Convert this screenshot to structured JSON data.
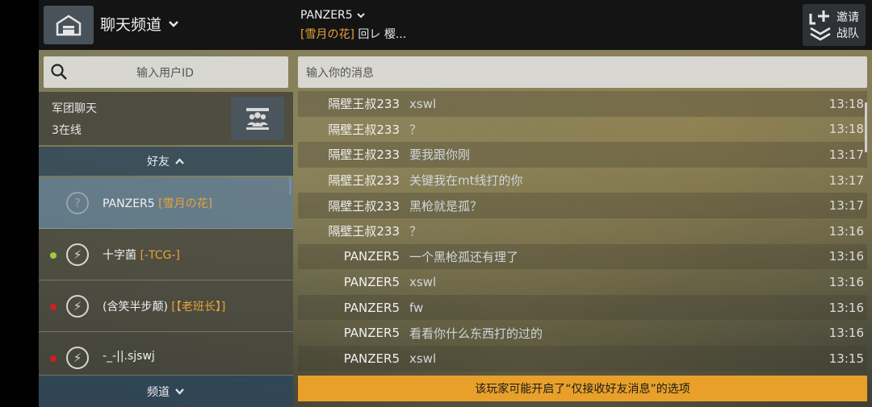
{
  "header": {
    "channel_title": "聊天频道",
    "chat_title": "PANZER5",
    "chat_sub_tag": "[雪月の花]",
    "chat_sub_rest": " 回レ 樱...",
    "invite_label": "邀请 战队"
  },
  "left": {
    "search_placeholder": "输入用户ID",
    "legion_title": "军团聊天",
    "legion_online": "3在线",
    "friends_header": "好友",
    "friends": [
      {
        "name": "PANZER5 ",
        "tag": "[雪月の花]",
        "status": "",
        "icon": "question-icon"
      },
      {
        "name": "十字菌 ",
        "tag": "[-TCG-]",
        "status": "#9ccc3c",
        "icon": "lightning-icon"
      },
      {
        "name": "(含笑半步颠) ",
        "tag": "[【老班长】]",
        "status": "#d02020",
        "icon": "lightning-icon"
      },
      {
        "name": "-_-||.sjswj",
        "tag": "",
        "status": "#d02020",
        "icon": "lightning-icon"
      }
    ],
    "channel_button": "频道"
  },
  "chat": {
    "input_placeholder": "输入你的消息",
    "messages": [
      {
        "sender": "隔壁王叔233",
        "text": "xswl",
        "time": "13:18"
      },
      {
        "sender": "隔壁王叔233",
        "text": "？",
        "time": "13:18"
      },
      {
        "sender": "隔壁王叔233",
        "text": "要我跟你刚",
        "time": "13:17"
      },
      {
        "sender": "隔壁王叔233",
        "text": "关键我在mt线打的你",
        "time": "13:17"
      },
      {
        "sender": "隔壁王叔233",
        "text": "黑枪就是孤？",
        "time": "13:17"
      },
      {
        "sender": "隔壁王叔233",
        "text": "？",
        "time": "13:16"
      },
      {
        "sender": "PANZER5",
        "text": "一个黑枪孤还有理了",
        "time": "13:16"
      },
      {
        "sender": "PANZER5",
        "text": "xswl",
        "time": "13:16"
      },
      {
        "sender": "PANZER5",
        "text": "fw",
        "time": "13:16"
      },
      {
        "sender": "PANZER5",
        "text": "看看你什么东西打的过的",
        "time": "13:16"
      },
      {
        "sender": "PANZER5",
        "text": "xswl",
        "time": "13:15"
      }
    ],
    "warning": "该玩家可能开启了“仅接收好友消息”的选项"
  },
  "colors": {
    "accent_orange": "#e8a02a",
    "tag_orange": "#e8a23a",
    "panel_blue": "#2d465a"
  }
}
